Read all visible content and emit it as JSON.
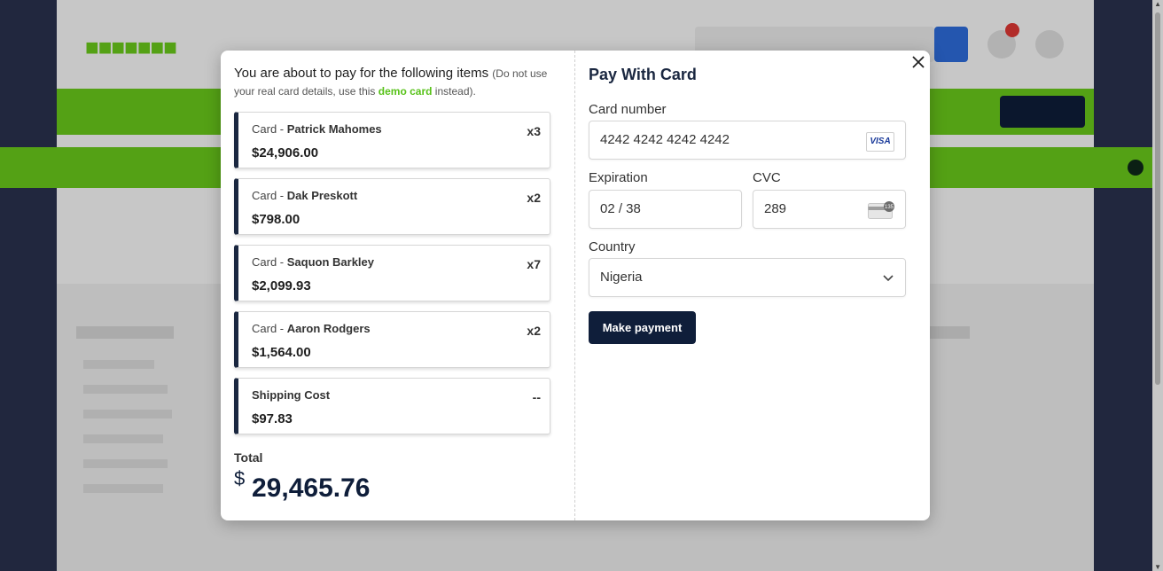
{
  "modal": {
    "intro_main": "You are about to pay for the following items",
    "intro_note_before": "(Do not use your real card details, use this",
    "intro_note_link": "demo card",
    "intro_note_after": "instead).",
    "items": [
      {
        "prefix": "Card - ",
        "name": "Patrick Mahomes",
        "price": "$24,906.00",
        "qty": "x3"
      },
      {
        "prefix": "Card - ",
        "name": "Dak Preskott",
        "price": "$798.00",
        "qty": "x2"
      },
      {
        "prefix": "Card - ",
        "name": "Saquon Barkley",
        "price": "$2,099.93",
        "qty": "x7"
      },
      {
        "prefix": "Card - ",
        "name": "Aaron Rodgers",
        "price": "$1,564.00",
        "qty": "x2"
      },
      {
        "prefix": "",
        "name": "Shipping Cost",
        "price": "$97.83",
        "qty": "--"
      }
    ],
    "total_label": "Total",
    "total_currency": "$",
    "total_amount": "29,465.76"
  },
  "payment": {
    "title": "Pay With Card",
    "card_number_label": "Card number",
    "card_number_value": "4242 4242 4242 4242",
    "card_brand": "VISA",
    "expiration_label": "Expiration",
    "expiration_value": "02 / 38",
    "cvc_label": "CVC",
    "cvc_value": "289",
    "cvc_badge": "135",
    "country_label": "Country",
    "country_value": "Nigeria",
    "submit_label": "Make payment"
  },
  "colors": {
    "navy": "#0f1e3a",
    "brand_green": "#6ccf1c",
    "demo_link": "#58c21a",
    "item_accent": "#1a2740"
  }
}
